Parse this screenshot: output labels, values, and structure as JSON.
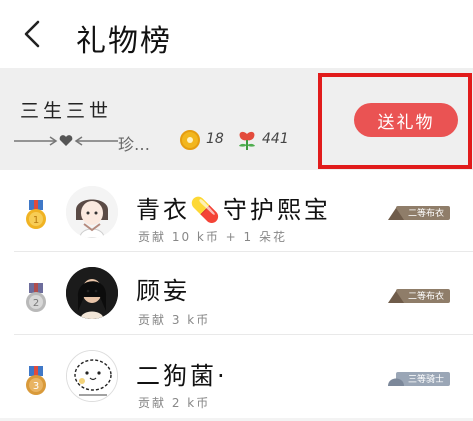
{
  "header": {
    "title": "礼物榜",
    "back_icon": "chevron-left-icon"
  },
  "summary": {
    "user_name": "三生三世",
    "motto": "珍…",
    "coins": "18",
    "flowers": "441",
    "send_button": "送礼物",
    "accent_color": "#ea5353",
    "highlight_color": "#e11b1b"
  },
  "ranking": [
    {
      "rank": "1",
      "name": "青衣💊守护熙宝",
      "contribution": "贡献 10 k币 + 1 朵花",
      "badge": "二等布衣",
      "medal_color": "#f0b323"
    },
    {
      "rank": "2",
      "name": "顾妄",
      "contribution": "贡献 3 k币",
      "badge": "二等布衣",
      "medal_color": "#b9b9b9"
    },
    {
      "rank": "3",
      "name": "二狗菌·",
      "contribution": "贡献 2 k币",
      "badge": "三等骑士",
      "medal_color": "#d99a3a"
    }
  ]
}
